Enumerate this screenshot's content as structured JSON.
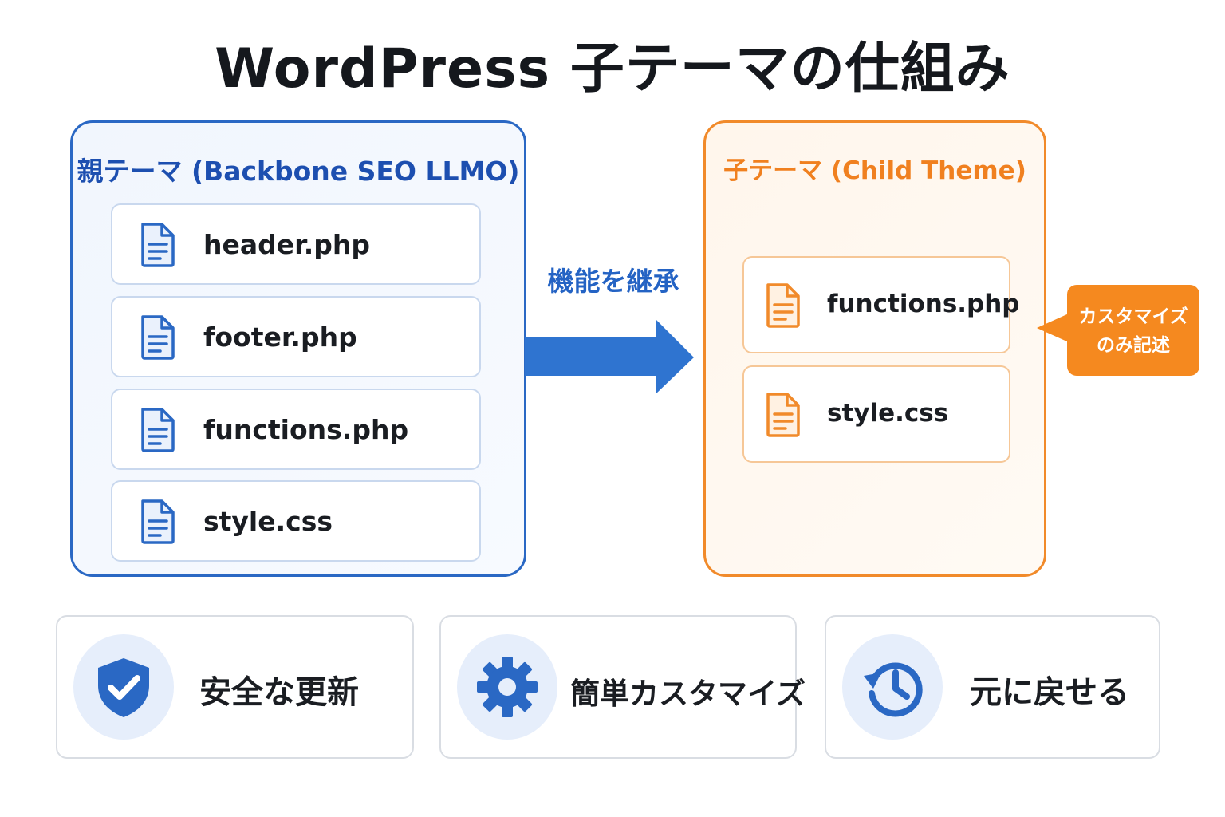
{
  "title": "WordPress 子テーマの仕組み",
  "colors": {
    "parent_accent": "#2a68c4",
    "child_accent": "#f18a2a",
    "arrow": "#2f74d0",
    "callout": "#f5891f"
  },
  "parent_theme": {
    "title": "親テーマ (Backbone SEO LLMO)",
    "files": [
      {
        "icon": "document-icon",
        "name": "header.php"
      },
      {
        "icon": "document-icon",
        "name": "footer.php"
      },
      {
        "icon": "document-icon",
        "name": "functions.php"
      },
      {
        "icon": "document-icon",
        "name": "style.css"
      }
    ]
  },
  "inherit_label": "機能を継承",
  "child_theme": {
    "title": "子テーマ (Child Theme)",
    "files": [
      {
        "icon": "document-icon",
        "name": "functions.php"
      },
      {
        "icon": "document-icon",
        "name": "style.css"
      }
    ]
  },
  "callout": {
    "line1": "カスタマイズ",
    "line2": "のみ記述"
  },
  "benefits": [
    {
      "icon": "shield-check-icon",
      "label": "安全な更新"
    },
    {
      "icon": "gear-icon",
      "label": "簡単カスタマイズ"
    },
    {
      "icon": "history-icon",
      "label": "元に戻せる"
    }
  ]
}
